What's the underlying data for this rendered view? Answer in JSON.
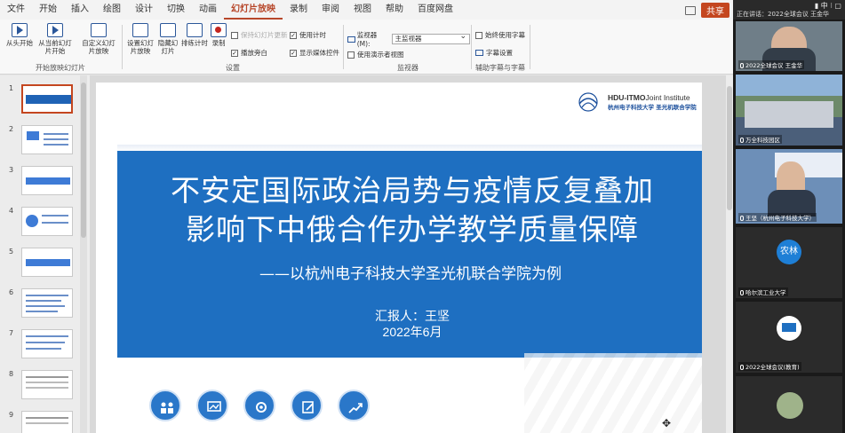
{
  "tabs": [
    "文件",
    "开始",
    "插入",
    "绘图",
    "设计",
    "切换",
    "动画",
    "幻灯片放映",
    "录制",
    "审阅",
    "视图",
    "帮助",
    "百度网盘"
  ],
  "active_tab": "幻灯片放映",
  "share_label": "共享",
  "ribbon": {
    "group_start": {
      "label": "开始放映幻灯片",
      "btn_from_start": "从头开始",
      "btn_from_current": "从当前幻灯片开始",
      "btn_custom": "自定义幻灯片放映"
    },
    "group_setup": {
      "label": "设置",
      "btn_setup": "设置幻灯片放映",
      "btn_hide": "隐藏幻灯片",
      "btn_rehearse": "排练计时",
      "btn_record": "录制",
      "chk_keep_updated": "保持幻灯片更新",
      "chk_play_narration": "播放旁白",
      "chk_use_timings": "使用计时",
      "chk_show_media": "显示媒体控件"
    },
    "group_monitor": {
      "label": "监视器",
      "monitor_label": "监视器(M):",
      "monitor_value": "主监视器",
      "chk_presenter_view": "使用演示者视图"
    },
    "group_captions": {
      "label": "辅助字幕与字幕",
      "chk_always_subtitles": "始终使用字幕",
      "btn_subtitle_settings": "字幕设置"
    }
  },
  "thumbnails": [
    {
      "num": "1",
      "selected": true
    },
    {
      "num": "2",
      "selected": false
    },
    {
      "num": "3",
      "selected": false
    },
    {
      "num": "4",
      "selected": false
    },
    {
      "num": "5",
      "selected": false
    },
    {
      "num": "6",
      "selected": false
    },
    {
      "num": "7",
      "selected": false
    },
    {
      "num": "8",
      "selected": false
    },
    {
      "num": "9",
      "selected": false
    }
  ],
  "slide": {
    "logo_line1": "HDU-ITMO",
    "logo_line1b": "Joint Institute",
    "logo_line2": "杭州电子科技大学 圣光机联合学院",
    "title_line1": "不安定国际政治局势与疫情反复叠加",
    "title_line2": "影响下中俄合作办学教学质量保障",
    "subtitle": "——以杭州电子科技大学圣光机联合学院为例",
    "reporter": "汇报人：王坚",
    "date": "2022年6月",
    "band_color": "#1e6fc1"
  },
  "video_panel": {
    "top_text": "正在讲话：2022全球会议 王金华",
    "tiles": [
      {
        "label": "2022全球会议 王金华"
      },
      {
        "label": "万全科技园区"
      },
      {
        "label": "王坚（杭州电子科技大学）"
      },
      {
        "label": "哈尔滨工业大学",
        "avatar": "农林"
      },
      {
        "label": "2022全球会议(教育)"
      },
      {
        "label": ""
      }
    ]
  }
}
